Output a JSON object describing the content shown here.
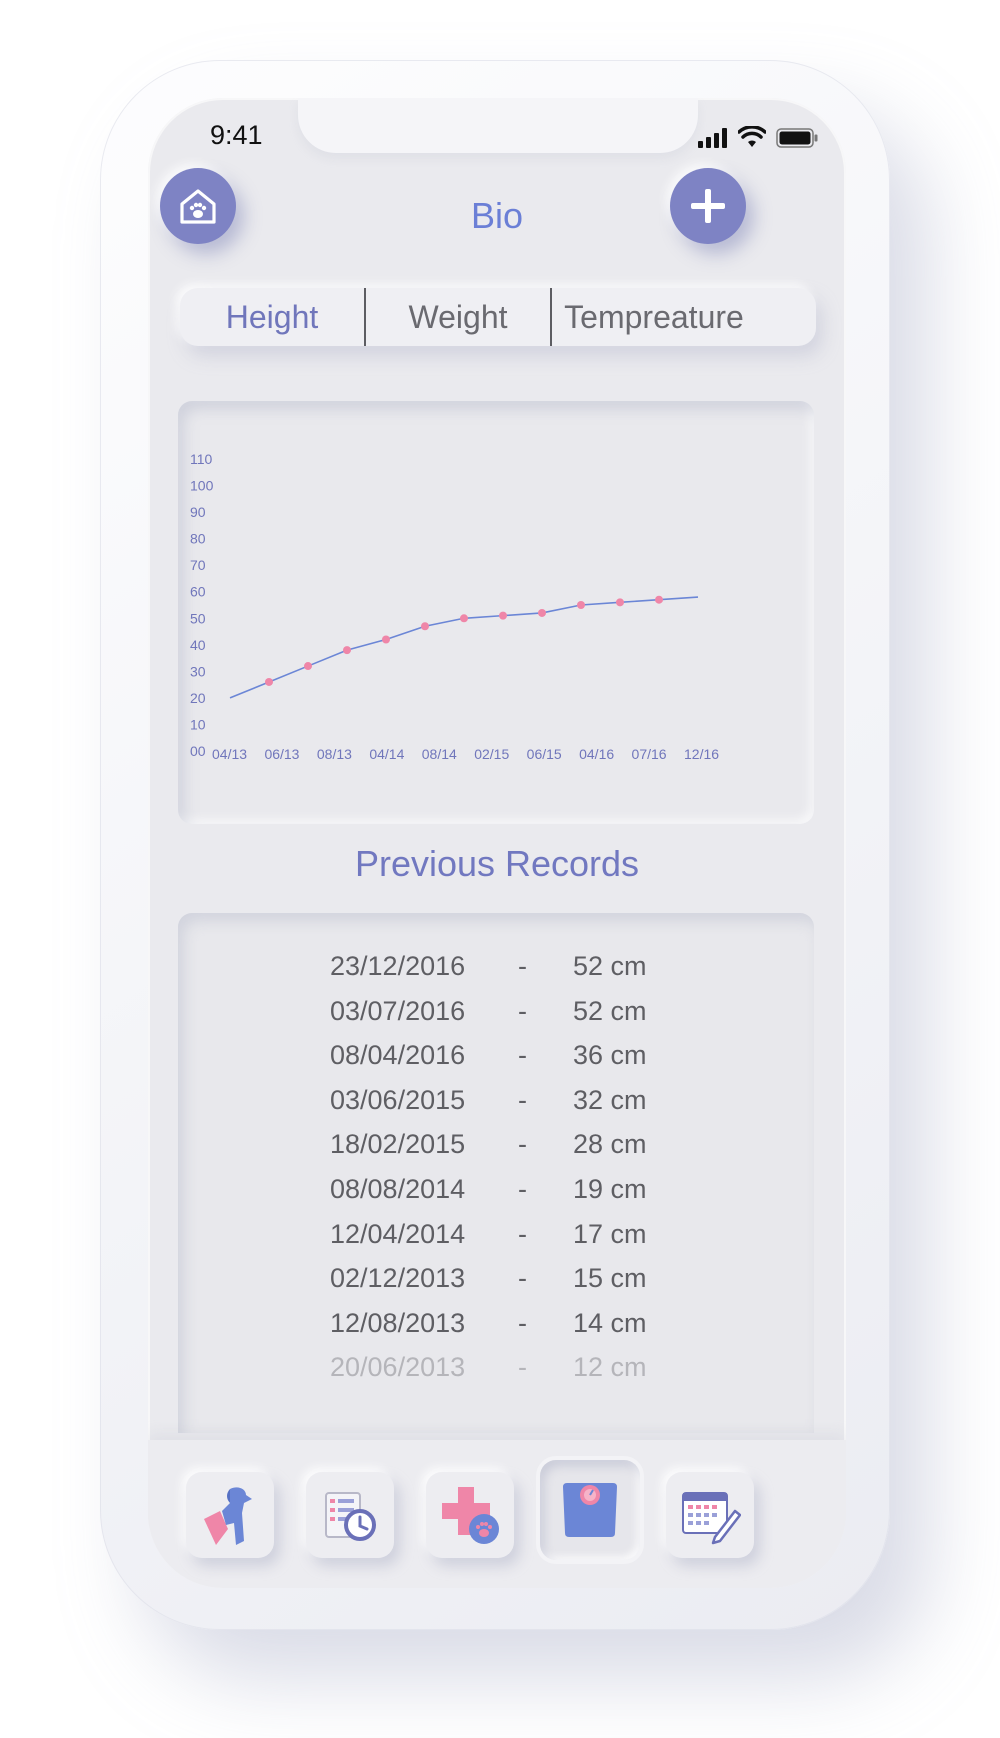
{
  "status": {
    "time": "9:41"
  },
  "header": {
    "title": "Bio",
    "home_icon": "home-paw-icon",
    "add_icon": "plus-icon"
  },
  "tabs": [
    {
      "label": "Height",
      "active": true
    },
    {
      "label": "Weight",
      "active": false
    },
    {
      "label": "Tempreature",
      "active": false
    }
  ],
  "chart_data": {
    "type": "line",
    "title": "",
    "xlabel": "",
    "ylabel": "",
    "y_ticks": [
      "00",
      "10",
      "20",
      "30",
      "40",
      "50",
      "60",
      "70",
      "80",
      "90",
      "100",
      "110"
    ],
    "ylim": [
      0,
      110
    ],
    "categories": [
      "04/13",
      "06/13",
      "08/13",
      "04/14",
      "08/14",
      "02/15",
      "06/15",
      "04/16",
      "07/16",
      "12/16"
    ],
    "series": [
      {
        "x": [
          0,
          1,
          2,
          3,
          4,
          5,
          6,
          7,
          8,
          9,
          10,
          11,
          12
        ],
        "values": [
          20,
          26,
          32,
          38,
          42,
          47,
          50,
          51,
          52,
          55,
          56,
          57,
          58
        ],
        "markers": [
          false,
          true,
          true,
          true,
          true,
          true,
          true,
          true,
          true,
          true,
          true,
          true,
          false
        ]
      }
    ],
    "line_color": "#6b86d6",
    "marker_color": "#ef86a8",
    "grid": false
  },
  "records": {
    "title": "Previous Records",
    "rows": [
      {
        "date": "23/12/2016",
        "sep": "-",
        "value": "52 cm"
      },
      {
        "date": "03/07/2016",
        "sep": "-",
        "value": "52 cm"
      },
      {
        "date": "08/04/2016",
        "sep": "-",
        "value": "36 cm"
      },
      {
        "date": "03/06/2015",
        "sep": "-",
        "value": "32 cm"
      },
      {
        "date": "18/02/2015",
        "sep": "-",
        "value": "28 cm"
      },
      {
        "date": "08/08/2014",
        "sep": "-",
        "value": "19 cm"
      },
      {
        "date": "12/04/2014",
        "sep": "-",
        "value": "17 cm"
      },
      {
        "date": "02/12/2013",
        "sep": "-",
        "value": "15 cm"
      },
      {
        "date": "12/08/2013",
        "sep": "-",
        "value": "14 cm"
      },
      {
        "date": "20/06/2013",
        "sep": "-",
        "value": "12 cm"
      }
    ]
  },
  "bottom_nav": [
    {
      "icon": "dog-profile-icon",
      "active": false
    },
    {
      "icon": "history-list-icon",
      "active": false
    },
    {
      "icon": "medical-cross-paw-icon",
      "active": false
    },
    {
      "icon": "weight-scale-icon",
      "active": true
    },
    {
      "icon": "calendar-edit-icon",
      "active": false
    }
  ],
  "colors": {
    "accent": "#7e83c4",
    "title_blue": "#6b7fd6",
    "pink": "#ef86a8"
  }
}
